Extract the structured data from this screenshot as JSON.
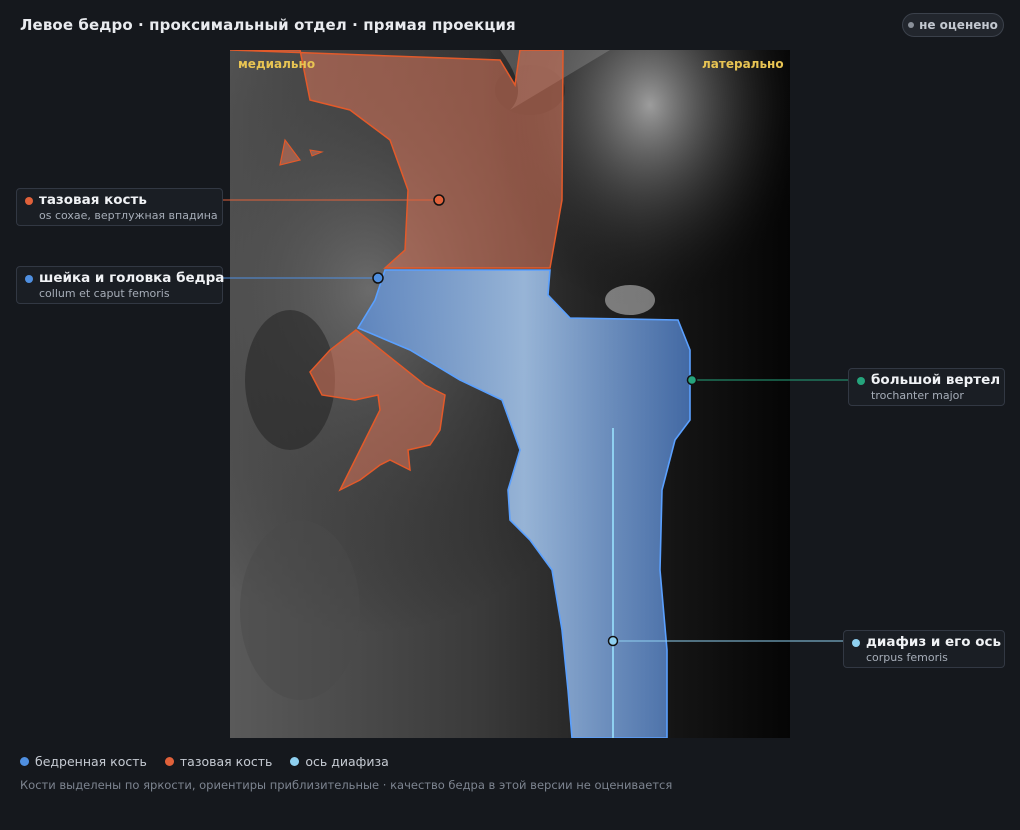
{
  "header": {
    "title": "Левое бедро · проксимальный отдел · прямая проекция",
    "status_badge": "не оценено"
  },
  "viewer": {
    "orientation_left": "медиально",
    "orientation_right": "латерально"
  },
  "annotations": [
    {
      "title": "тазовая кость",
      "subtitle": "os coxae, вертлужная впадина",
      "color": "#e0613a"
    },
    {
      "title": "шейка и головка бедра",
      "subtitle": "collum et caput femoris",
      "color": "#4f8fe0"
    },
    {
      "title": "большой вертел",
      "subtitle": "trochanter major",
      "color": "#25a47c"
    },
    {
      "title": "диафиз и его ось",
      "subtitle": "corpus femoris",
      "color": "#8fd0f0"
    }
  ],
  "legend": [
    {
      "label": "бедренная кость",
      "color": "#4f8fe0"
    },
    {
      "label": "тазовая кость",
      "color": "#e0613a"
    },
    {
      "label": "ось диафиза",
      "color": "#8fd0f0"
    }
  ],
  "footnote": "Кости выделены по яркости, ориентиры приблизительные · качество бедра в этой версии не оценивается"
}
